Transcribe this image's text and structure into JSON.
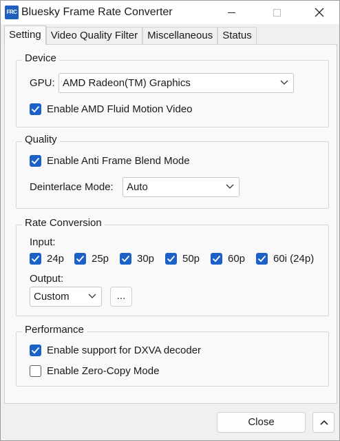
{
  "window": {
    "app_icon_text": "FRC",
    "title": "Bluesky Frame Rate Converter"
  },
  "tabs": [
    {
      "label": "Setting",
      "active": true
    },
    {
      "label": "Video Quality Filter",
      "active": false
    },
    {
      "label": "Miscellaneous",
      "active": false
    },
    {
      "label": "Status",
      "active": false
    }
  ],
  "device": {
    "group_title": "Device",
    "gpu_label": "GPU:",
    "gpu_value": "AMD Radeon(TM) Graphics",
    "fluid_motion_label": "Enable AMD Fluid Motion Video",
    "fluid_motion_checked": true
  },
  "quality": {
    "group_title": "Quality",
    "anti_blend_label": "Enable Anti Frame Blend Mode",
    "anti_blend_checked": true,
    "deinterlace_label": "Deinterlace Mode:",
    "deinterlace_value": "Auto"
  },
  "rate_conversion": {
    "group_title": "Rate Conversion",
    "input_label": "Input:",
    "inputs": [
      {
        "label": "24p",
        "checked": true
      },
      {
        "label": "25p",
        "checked": true
      },
      {
        "label": "30p",
        "checked": true
      },
      {
        "label": "50p",
        "checked": true
      },
      {
        "label": "60p",
        "checked": true
      },
      {
        "label": "60i (24p)",
        "checked": true
      }
    ],
    "output_label": "Output:",
    "output_value": "Custom",
    "more_button_label": "..."
  },
  "performance": {
    "group_title": "Performance",
    "dxva_label": "Enable support for DXVA decoder",
    "dxva_checked": true,
    "zero_copy_label": "Enable Zero-Copy Mode",
    "zero_copy_checked": false
  },
  "footer": {
    "close_label": "Close"
  },
  "colors": {
    "accent": "#1b61c8",
    "app_icon": "#1f5fbf"
  }
}
